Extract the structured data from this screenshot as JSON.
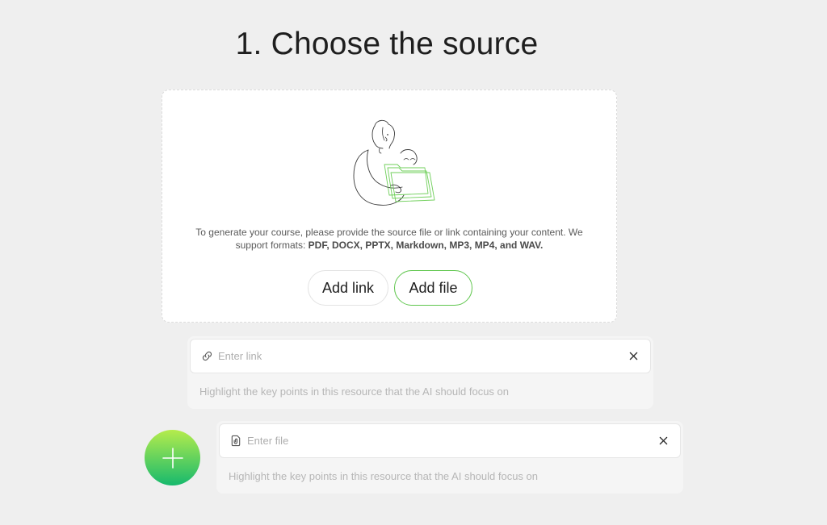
{
  "header": {
    "title": "1. Choose the source"
  },
  "upload": {
    "illustration": "person-with-folder-illustration",
    "description_prefix": "To generate your course, please provide the source file or link containing your content. We support formats: ",
    "formats": "PDF, DOCX, PPTX, Markdown, MP3, MP4, and WAV.",
    "add_link_label": "Add link",
    "add_file_label": "Add file",
    "accent_color": "#5fc64d"
  },
  "link_source": {
    "icon": "link-icon",
    "placeholder": "Enter link",
    "value": "",
    "hint_placeholder": "Highlight the key points in this resource that the AI should focus on",
    "close_icon": "close-icon"
  },
  "file_source": {
    "icon": "file-icon",
    "placeholder": "Enter file",
    "value": "",
    "hint_placeholder": "Highlight the key points in this resource that the AI should focus on",
    "close_icon": "close-icon"
  },
  "add_source": {
    "icon": "plus-icon",
    "gradient_top": "#b5ec4c",
    "gradient_bottom": "#16b96d"
  }
}
